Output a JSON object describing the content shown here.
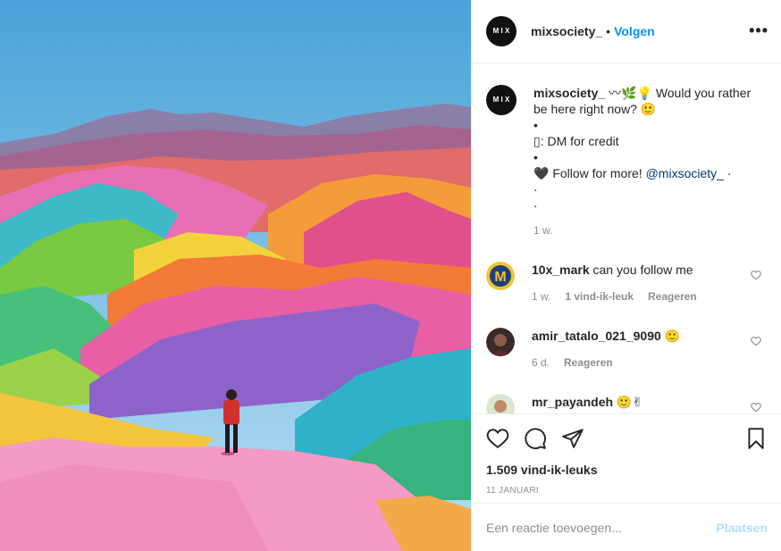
{
  "header": {
    "username": "mixsociety_",
    "separator": "•",
    "follow_label": "Volgen",
    "more_label": "•••",
    "logo_text": "M I X"
  },
  "caption": {
    "username": "mixsociety_",
    "line1": " 〰🌿💡 Would you rather be here right now? 🙂",
    "line2": "•",
    "line3": "▯: DM for credit",
    "line4": "•",
    "line5_text": "🖤 Follow for more! ",
    "line5_mention": "@mixsociety_",
    "line5_suffix": " ·",
    "line6": "·",
    "line7": "·",
    "time": "1 w."
  },
  "comments": [
    {
      "username": "10x_mark",
      "text": " can you follow me",
      "time": "1 w.",
      "likes": "1 vind-ik-leuk",
      "reply": "Reageren"
    },
    {
      "username": "amir_tatalo_021_9090",
      "text": " 🙂",
      "time": "6 d.",
      "reply": "Reageren"
    },
    {
      "username": "mr_payandeh",
      "text": " 🙂✌"
    }
  ],
  "actions": {
    "likes_count": "1.509 vind-ik-leuks",
    "date": "11 JANUARI"
  },
  "add_comment": {
    "placeholder": "Een reactie toevoegen...",
    "post_label": "Plaatsen"
  },
  "colors": {
    "accent": "#0095f6",
    "post_disabled": "#b2dffc",
    "muted": "#8e8e8e"
  }
}
